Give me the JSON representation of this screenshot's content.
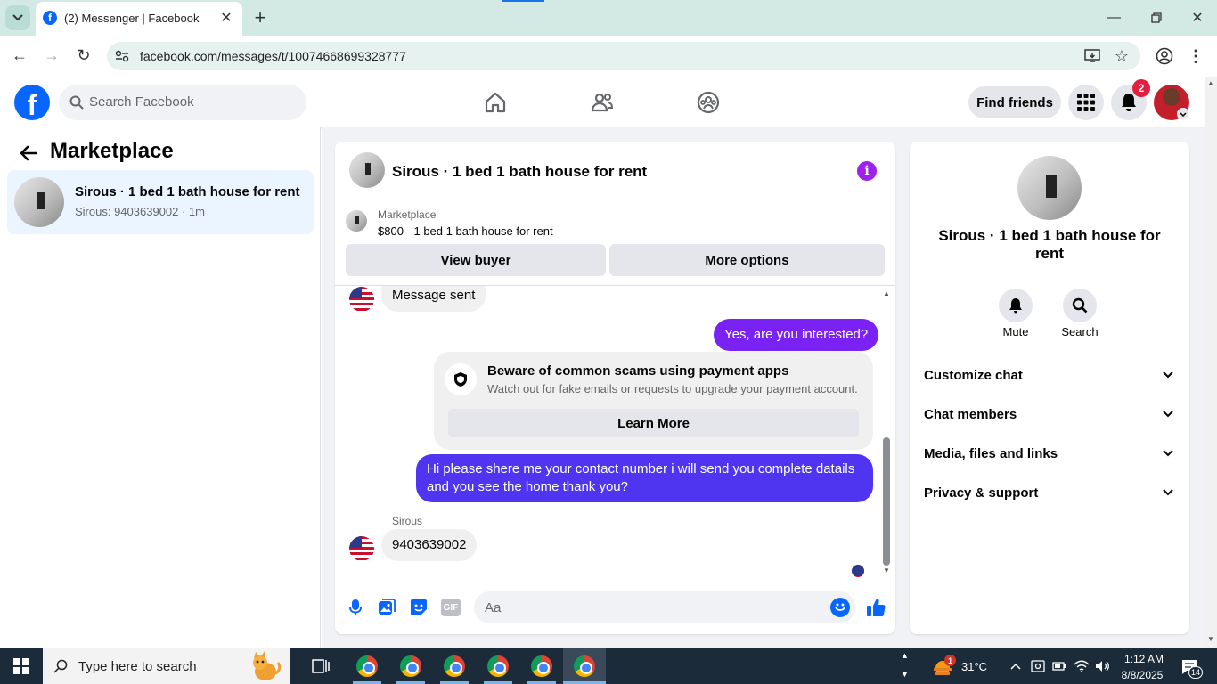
{
  "browser": {
    "tab_title": "(2) Messenger | Facebook",
    "url": "facebook.com/messages/t/10074668699328777"
  },
  "header": {
    "search_placeholder": "Search Facebook",
    "find_friends": "Find friends",
    "notification_count": "2"
  },
  "sidebar": {
    "title": "Marketplace",
    "conversation": {
      "name": "Sirous · 1 bed 1 bath house for rent",
      "preview": "Sirous: 9403639002 · 1m"
    }
  },
  "chat": {
    "title": "Sirous · 1 bed 1 bath house for rent",
    "listing_source": "Marketplace",
    "listing_title": "$800 - 1 bed 1 bath house for rent",
    "view_buyer": "View buyer",
    "more_options": "More options",
    "messages": {
      "m1": "Message sent",
      "m2": "Yes, are you interested?",
      "m3": "Hi please shere me your contact number i will send you complete datails and you see the home thank you?",
      "sender_name": "Sirous",
      "m4": "9403639002"
    },
    "scam_warning": {
      "title": "Beware of common scams using payment apps",
      "body": "Watch out for fake emails or requests to upgrade your payment account.",
      "button": "Learn More"
    },
    "composer_placeholder": "Aa"
  },
  "info_panel": {
    "name": "Sirous · 1 bed 1 bath house for rent",
    "mute_label": "Mute",
    "search_label": "Search",
    "sections": [
      "Customize chat",
      "Chat members",
      "Media, files and links",
      "Privacy & support"
    ]
  },
  "taskbar": {
    "search_placeholder": "Type here to search",
    "weather_badge": "1",
    "temperature": "31°C",
    "time": "1:12 AM",
    "date": "8/8/2025",
    "notifications": "14"
  },
  "colors": {
    "fb_blue": "#0866ff",
    "outgoing_bubble": "#7a21f4",
    "second_bubble": "#4f35f0",
    "info_icon": "#a020f0"
  }
}
